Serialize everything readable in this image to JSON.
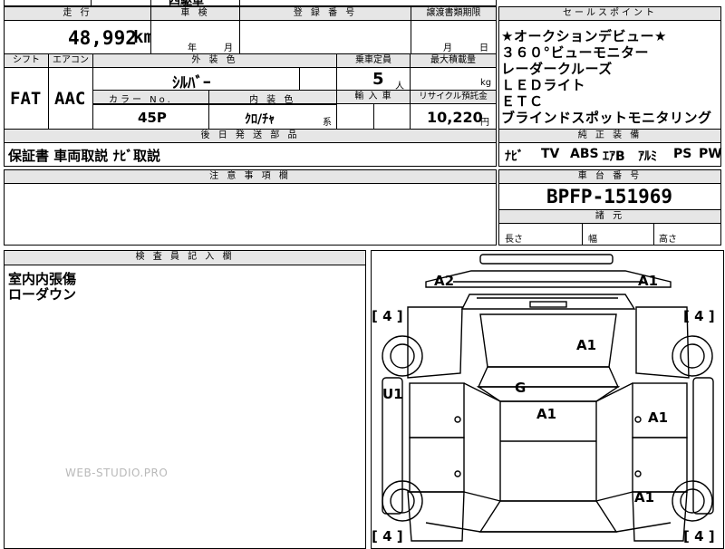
{
  "top_partial": {
    "text": "四駆車"
  },
  "mileage": {
    "header": "走 行",
    "value": "48,992",
    "unit": "km"
  },
  "inspection": {
    "header": "車 検",
    "year_label": "年",
    "month_label": "月"
  },
  "registration": {
    "header": "登 録 番 号",
    "value": ""
  },
  "transfer_deadline": {
    "header": "譲渡書類期限",
    "month_label": "月",
    "day_label": "日"
  },
  "shift": {
    "header": "シフト",
    "value": "FAT"
  },
  "aircon": {
    "header": "エアコン",
    "value": "AAC"
  },
  "exterior_color": {
    "header": "外 装 色",
    "value": "ｼﾙﾊﾞｰ"
  },
  "color_no": {
    "header": "カラー No.",
    "value": "45P"
  },
  "interior_color": {
    "header": "内 装 色",
    "value": "ｸﾛ/ﾁｬ",
    "suffix": "系"
  },
  "capacity": {
    "header": "乗車定員",
    "value": "5",
    "unit": "人"
  },
  "max_load": {
    "header": "最大積載量",
    "value": "",
    "unit": "kg"
  },
  "import": {
    "header": "輸 入 車",
    "value": ""
  },
  "recycle": {
    "header": "リサイクル預託金",
    "value": "10,220",
    "unit": "円"
  },
  "sales_points": {
    "header": "セールスポイント",
    "lines": [
      "★オークションデビュー★",
      "３６０°ビューモニター",
      "レーダークルーズ",
      "ＬＥＤライト",
      "ＥＴＣ",
      "ブラインドスポットモニタリング"
    ]
  },
  "parts": {
    "header": "後 日 発 送 部 品",
    "value": "保証書 車両取説 ﾅﾋﾞ取説"
  },
  "oem_equipment": {
    "header": "純 正 装 備",
    "items": [
      "ﾅﾋﾞ",
      "TV",
      "ABS",
      "ｴｱB",
      "ｱﾙﾐ",
      "PS",
      "PW"
    ]
  },
  "notes": {
    "header": "注 意 事 項 欄",
    "value": ""
  },
  "chassis": {
    "header": "車 台 番 号",
    "value": "BPFP-151969"
  },
  "dimensions": {
    "header": "諸 元",
    "length_label": "長さ",
    "width_label": "幅",
    "height_label": "高さ"
  },
  "inspector": {
    "header": "検 査 員 記 入 欄",
    "lines": [
      "室内内張傷",
      "ローダウン"
    ]
  },
  "condition_codes": {
    "a2": "A2",
    "a1_front_right": "A1",
    "a1_roof": "A1",
    "g_windshield": "G",
    "a1_roof_center": "A1",
    "a1_right_door": "A1",
    "a1_rear_right": "A1",
    "u1_left": "U1"
  },
  "tires": {
    "front_left": "[ 4 ]",
    "front_right": "[ 4 ]",
    "rear_left": "[ 4 ]",
    "rear_right": "[ 4 ]"
  },
  "watermark": "WEB-STUDIO.PRO"
}
